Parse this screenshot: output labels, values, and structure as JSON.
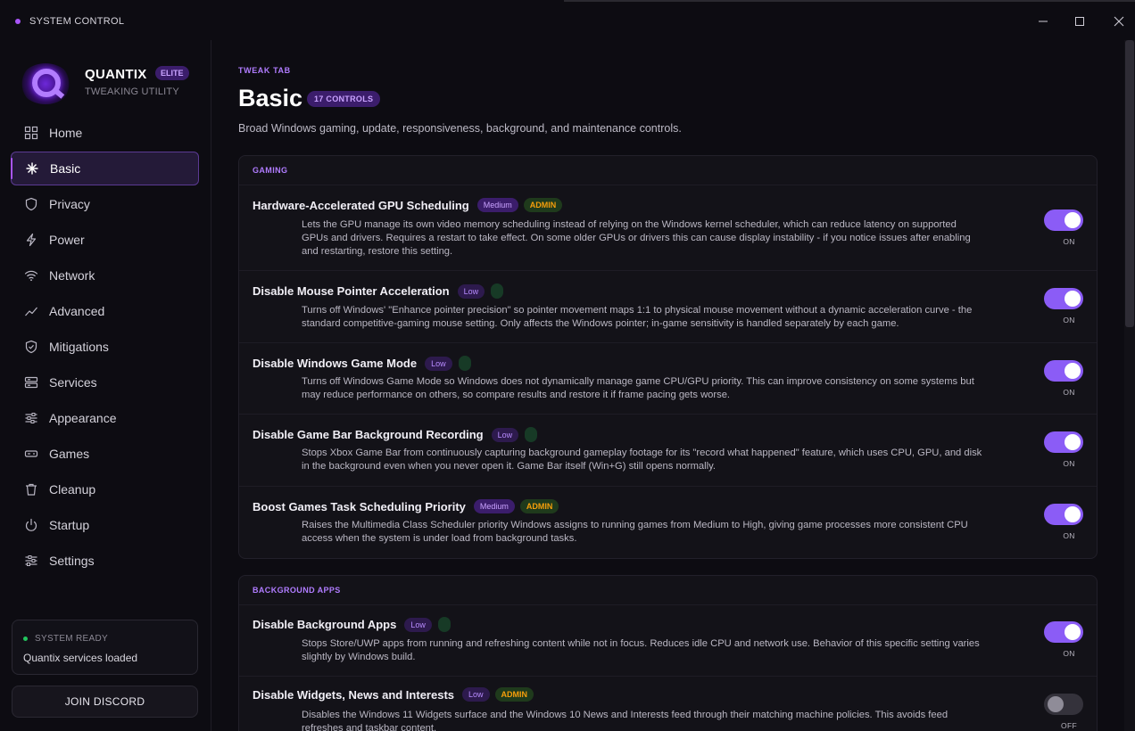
{
  "window": {
    "title": "SYSTEM CONTROL",
    "minimize": "—",
    "maximize": "☐",
    "close": "✕"
  },
  "brand": {
    "name": "QUANTIX",
    "badge": "ELITE",
    "subtitle": "TWEAKING UTILITY"
  },
  "sidebar": {
    "items": [
      {
        "label": "Home",
        "icon": "grid-icon"
      },
      {
        "label": "Basic",
        "icon": "sparkle-icon",
        "active": true
      },
      {
        "label": "Privacy",
        "icon": "shield-icon"
      },
      {
        "label": "Power",
        "icon": "lightning-icon"
      },
      {
        "label": "Network",
        "icon": "wifi-icon"
      },
      {
        "label": "Advanced",
        "icon": "trend-icon"
      },
      {
        "label": "Mitigations",
        "icon": "shield-check-icon"
      },
      {
        "label": "Services",
        "icon": "server-icon"
      },
      {
        "label": "Appearance",
        "icon": "sliders-icon"
      },
      {
        "label": "Games",
        "icon": "gamepad-icon"
      },
      {
        "label": "Cleanup",
        "icon": "trash-icon"
      },
      {
        "label": "Startup",
        "icon": "power-icon"
      },
      {
        "label": "Settings",
        "icon": "settings-sliders-icon"
      }
    ],
    "status": {
      "label": "SYSTEM READY",
      "message": "Quantix services loaded"
    },
    "discord_label": "JOIN DISCORD"
  },
  "header": {
    "eyebrow": "TWEAK TAB",
    "title": "Basic",
    "count_badge": "17 CONTROLS",
    "subtitle": "Broad Windows gaming, update, responsiveness, background, and maintenance controls."
  },
  "sections": [
    {
      "heading": "GAMING",
      "rows": [
        {
          "title": "Hardware-Accelerated GPU Scheduling",
          "level": "Medium",
          "admin": "ADMIN",
          "desc": "Lets the GPU manage its own video memory scheduling instead of relying on the Windows kernel scheduler, which can reduce latency on supported GPUs and drivers. Requires a restart to take effect. On some older GPUs or drivers this can cause display instability - if you notice issues after enabling and restarting, restore this setting.",
          "state": "ON"
        },
        {
          "title": "Disable Mouse Pointer Acceleration",
          "level": "Low",
          "desc": "Turns off Windows' \"Enhance pointer precision\" so pointer movement maps 1:1 to physical mouse movement without a dynamic acceleration curve - the standard competitive-gaming mouse setting. Only affects the Windows pointer; in-game sensitivity is handled separately by each game.",
          "state": "ON"
        },
        {
          "title": "Disable Windows Game Mode",
          "level": "Low",
          "desc": "Turns off Windows Game Mode so Windows does not dynamically manage game CPU/GPU priority. This can improve consistency on some systems but may reduce performance on others, so compare results and restore it if frame pacing gets worse.",
          "state": "ON"
        },
        {
          "title": "Disable Game Bar Background Recording",
          "level": "Low",
          "desc": "Stops Xbox Game Bar from continuously capturing background gameplay footage for its \"record what happened\" feature, which uses CPU, GPU, and disk in the background even when you never open it. Game Bar itself (Win+G) still opens normally.",
          "state": "ON"
        },
        {
          "title": "Boost Games Task Scheduling Priority",
          "level": "Medium",
          "admin": "ADMIN",
          "desc": "Raises the Multimedia Class Scheduler priority Windows assigns to running games from Medium to High, giving game processes more consistent CPU access when the system is under load from background tasks.",
          "state": "ON"
        }
      ]
    },
    {
      "heading": "BACKGROUND APPS",
      "rows": [
        {
          "title": "Disable Background Apps",
          "level": "Low",
          "desc": "Stops Store/UWP apps from running and refreshing content while not in focus. Reduces idle CPU and network use. Behavior of this specific setting varies slightly by Windows build.",
          "state": "ON"
        },
        {
          "title": "Disable Widgets, News and Interests",
          "level": "Low",
          "admin": "ADMIN",
          "desc": "Disables the Windows 11 Widgets surface and the Windows 10 News and Interests feed through their matching machine policies. This avoids feed refreshes and taskbar content.",
          "state": "OFF"
        }
      ]
    }
  ]
}
